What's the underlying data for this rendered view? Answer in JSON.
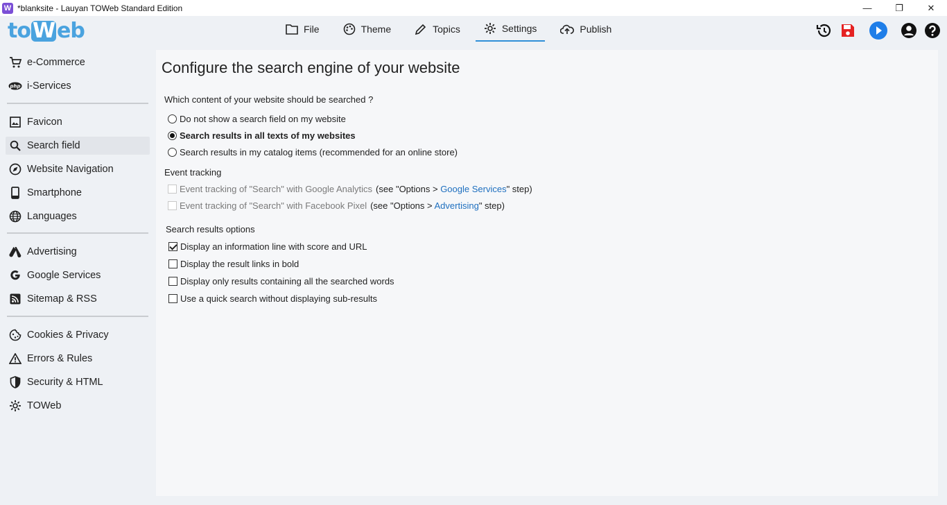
{
  "window": {
    "title": "*blanksite - Lauyan TOWeb Standard Edition",
    "app_icon_letter": "W",
    "minimize": "—",
    "restore": "❐",
    "close": "✕"
  },
  "logo": {
    "part1": "to",
    "part2": "W",
    "part3": "eb"
  },
  "menu": [
    {
      "label": "File",
      "icon": "folder-icon"
    },
    {
      "label": "Theme",
      "icon": "palette-icon"
    },
    {
      "label": "Topics",
      "icon": "pencil-icon"
    },
    {
      "label": "Settings",
      "icon": "gear-icon",
      "active": true
    },
    {
      "label": "Publish",
      "icon": "cloud-upload-icon"
    }
  ],
  "tools": [
    "history-icon",
    "save-icon",
    "preview-play-icon",
    "account-icon",
    "help-icon"
  ],
  "colors": {
    "accent": "#2f8fd8",
    "save": "#e52222",
    "play": "#1f7ee8",
    "link": "#1e6fbf"
  },
  "sidebar": {
    "items": [
      {
        "label": "e-Commerce",
        "icon": "cart-icon"
      },
      {
        "label": "i-Services",
        "icon": "php-icon"
      },
      {
        "label": "Favicon",
        "icon": "image-icon"
      },
      {
        "label": "Search field",
        "icon": "search-icon",
        "active": true
      },
      {
        "label": "Website Navigation",
        "icon": "compass-icon"
      },
      {
        "label": "Smartphone",
        "icon": "smartphone-icon"
      },
      {
        "label": "Languages",
        "icon": "globe-icon"
      },
      {
        "label": "Advertising",
        "icon": "ads-icon"
      },
      {
        "label": "Google Services",
        "icon": "google-icon"
      },
      {
        "label": "Sitemap & RSS",
        "icon": "rss-icon"
      },
      {
        "label": "Cookies & Privacy",
        "icon": "cookie-icon"
      },
      {
        "label": "Errors & Rules",
        "icon": "warning-icon"
      },
      {
        "label": "Security & HTML",
        "icon": "shield-icon"
      },
      {
        "label": "TOWeb",
        "icon": "gear-icon"
      }
    ]
  },
  "main": {
    "title": "Configure the search engine of your website",
    "question": "Which content of your website should be searched ?",
    "radios": [
      {
        "label": "Do not show a search field on my website",
        "checked": false
      },
      {
        "label": "Search results in all texts of my websites",
        "checked": true
      },
      {
        "label": "Search results in my catalog items (recommended for an online store)",
        "checked": false
      }
    ],
    "event_tracking": {
      "heading": "Event tracking",
      "items": [
        {
          "label": "Event tracking of \"Search\" with Google Analytics",
          "pre": "(see \"Options > ",
          "link": "Google Services",
          "post": "\" step)"
        },
        {
          "label": "Event tracking of \"Search\" with Facebook Pixel",
          "pre": "(see \"Options > ",
          "link": "Advertising",
          "post": "\" step)"
        }
      ]
    },
    "results_options": {
      "heading": "Search results options",
      "items": [
        {
          "label": "Display an information line with score and URL",
          "checked": true
        },
        {
          "label": "Display the result links in bold",
          "checked": false
        },
        {
          "label": "Display only results containing all the searched words",
          "checked": false
        },
        {
          "label": "Use a quick search without displaying sub-results",
          "checked": false
        }
      ]
    }
  }
}
